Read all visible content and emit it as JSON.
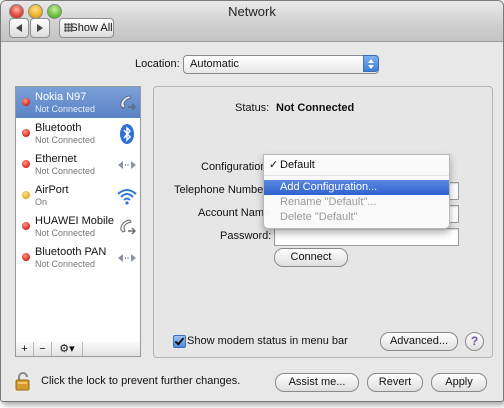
{
  "window": {
    "title": "Network"
  },
  "toolbar": {
    "show_all_label": "Show All"
  },
  "location": {
    "label": "Location:",
    "value": "Automatic"
  },
  "services": [
    {
      "name": "Nokia N97",
      "status": "Not Connected",
      "dot": "red",
      "icon": "phone-modem-icon",
      "selected": true
    },
    {
      "name": "Bluetooth",
      "status": "Not Connected",
      "dot": "red",
      "icon": "bluetooth-icon",
      "selected": false
    },
    {
      "name": "Ethernet",
      "status": "Not Connected",
      "dot": "red",
      "icon": "ethernet-arrows-icon",
      "selected": false
    },
    {
      "name": "AirPort",
      "status": "On",
      "dot": "amber",
      "icon": "wifi-icon",
      "selected": false
    },
    {
      "name": "HUAWEI Mobile",
      "status": "Not Connected",
      "dot": "red",
      "icon": "phone-modem-icon",
      "selected": false
    },
    {
      "name": "Bluetooth PAN",
      "status": "Not Connected",
      "dot": "red",
      "icon": "ethernet-arrows-icon",
      "selected": false
    }
  ],
  "sidebar_controls": {
    "add": "+",
    "remove": "−",
    "gear": "⚙▾"
  },
  "detail": {
    "status_label": "Status:",
    "status_value": "Not Connected",
    "configuration_label": "Configuration",
    "telephone_label": "Telephone Number",
    "account_label": "Account Name",
    "password_label": "Password:",
    "connect_label": "Connect",
    "show_status_label": "Show modem status in menu bar",
    "show_status_checked": true,
    "advanced_label": "Advanced...",
    "help_label": "?"
  },
  "config_menu": {
    "selected": "Default",
    "check": "✓",
    "items": [
      {
        "label": "Add Configuration...",
        "state": "highlighted"
      },
      {
        "label": "Rename \"Default\"...",
        "state": "disabled"
      },
      {
        "label": "Delete \"Default\"",
        "state": "disabled"
      }
    ]
  },
  "footer": {
    "lock_text": "Click the lock to prevent further changes.",
    "assist_label": "Assist me...",
    "revert_label": "Revert",
    "apply_label": "Apply"
  },
  "colors": {
    "selection": "#5a82c4",
    "menu_highlight": "#2f62cf",
    "status_red": "#d4251a",
    "status_amber": "#e6a417"
  }
}
